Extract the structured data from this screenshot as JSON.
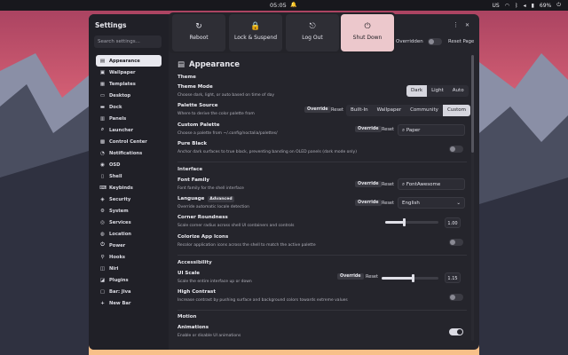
{
  "topbar": {
    "time": "05:05",
    "lang": "US",
    "battery": "69%"
  },
  "power_menu": {
    "buttons": [
      {
        "label": "Reboot",
        "icon": "↻"
      },
      {
        "label": "Lock & Suspend",
        "icon": "🔒"
      },
      {
        "label": "Log Out",
        "icon": "⎋"
      },
      {
        "label": "Shut Down",
        "icon": "⏻"
      }
    ]
  },
  "sidebar": {
    "title": "Settings",
    "search_placeholder": "Search settings...",
    "items": [
      {
        "label": "Appearance",
        "icon": "▤"
      },
      {
        "label": "Wallpaper",
        "icon": "▣"
      },
      {
        "label": "Templates",
        "icon": "▦"
      },
      {
        "label": "Desktop",
        "icon": "▭"
      },
      {
        "label": "Dock",
        "icon": "▬"
      },
      {
        "label": "Panels",
        "icon": "▥"
      },
      {
        "label": "Launcher",
        "icon": "⌕"
      },
      {
        "label": "Control Center",
        "icon": "▩"
      },
      {
        "label": "Notifications",
        "icon": "◔"
      },
      {
        "label": "OSD",
        "icon": "◉"
      },
      {
        "label": "Shell",
        "icon": "▯"
      },
      {
        "label": "Keybinds",
        "icon": "⌨"
      },
      {
        "label": "Security",
        "icon": "◈"
      },
      {
        "label": "System",
        "icon": "⚙"
      },
      {
        "label": "Services",
        "icon": "◎"
      },
      {
        "label": "Location",
        "icon": "◍"
      },
      {
        "label": "Power",
        "icon": "⏻"
      },
      {
        "label": "Hooks",
        "icon": "⚲"
      },
      {
        "label": "Niri",
        "icon": "◫"
      },
      {
        "label": "Plugins",
        "icon": "◪"
      },
      {
        "label": "Bar: Jiva",
        "icon": "▢"
      },
      {
        "label": "New Bar",
        "icon": "+"
      }
    ]
  },
  "header": {
    "overridden_label": "Overridden",
    "reset_page": "Reset Page",
    "more": "⋮",
    "close": "✕"
  },
  "page": {
    "title": "Appearance",
    "title_icon": "▤",
    "common": {
      "override": "Override",
      "reset": "Reset"
    },
    "sections": {
      "theme": "Theme",
      "interface": "Interface",
      "accessibility": "Accessibility",
      "motion": "Motion"
    },
    "theme_mode": {
      "label": "Theme Mode",
      "desc": "Choose dark, light, or auto based on time of day",
      "options": [
        "Dark",
        "Light",
        "Auto"
      ],
      "selected": 0
    },
    "palette_source": {
      "label": "Palette Source",
      "desc": "Where to derive the color palette from",
      "options": [
        "Built-In",
        "Wallpaper",
        "Community",
        "Custom"
      ],
      "selected": 3
    },
    "custom_palette": {
      "label": "Custom Palette",
      "desc": "Choose a palette from ~/.config/noctalia/palettes/",
      "value": "Paper"
    },
    "pure_black": {
      "label": "Pure Black",
      "desc": "Anchor dark surfaces to true black, preventing banding on OLED panels (dark mode only)",
      "on": false
    },
    "font_family": {
      "label": "Font Family",
      "desc": "Font family for the shell interface",
      "value": "FontAwesome"
    },
    "language": {
      "label": "Language",
      "badge": "Advanced",
      "desc": "Override automatic locale detection",
      "value": "English"
    },
    "corner_roundness": {
      "label": "Corner Roundness",
      "desc": "Scale corner radius across shell UI containers and controls",
      "value": "1.00",
      "level": 0.35
    },
    "colorize_icons": {
      "label": "Colorize App Icons",
      "desc": "Recolor application icons across the shell to match the active palette",
      "on": false
    },
    "ui_scale": {
      "label": "UI Scale",
      "desc": "Scale the entire interface up or down",
      "value": "1.15",
      "level": 0.55
    },
    "high_contrast": {
      "label": "High Contrast",
      "desc": "Increase contrast by pushing surface and background colors towards extreme values",
      "on": false
    },
    "animations": {
      "label": "Animations",
      "desc": "Enable or disable UI animations",
      "on": true
    }
  }
}
